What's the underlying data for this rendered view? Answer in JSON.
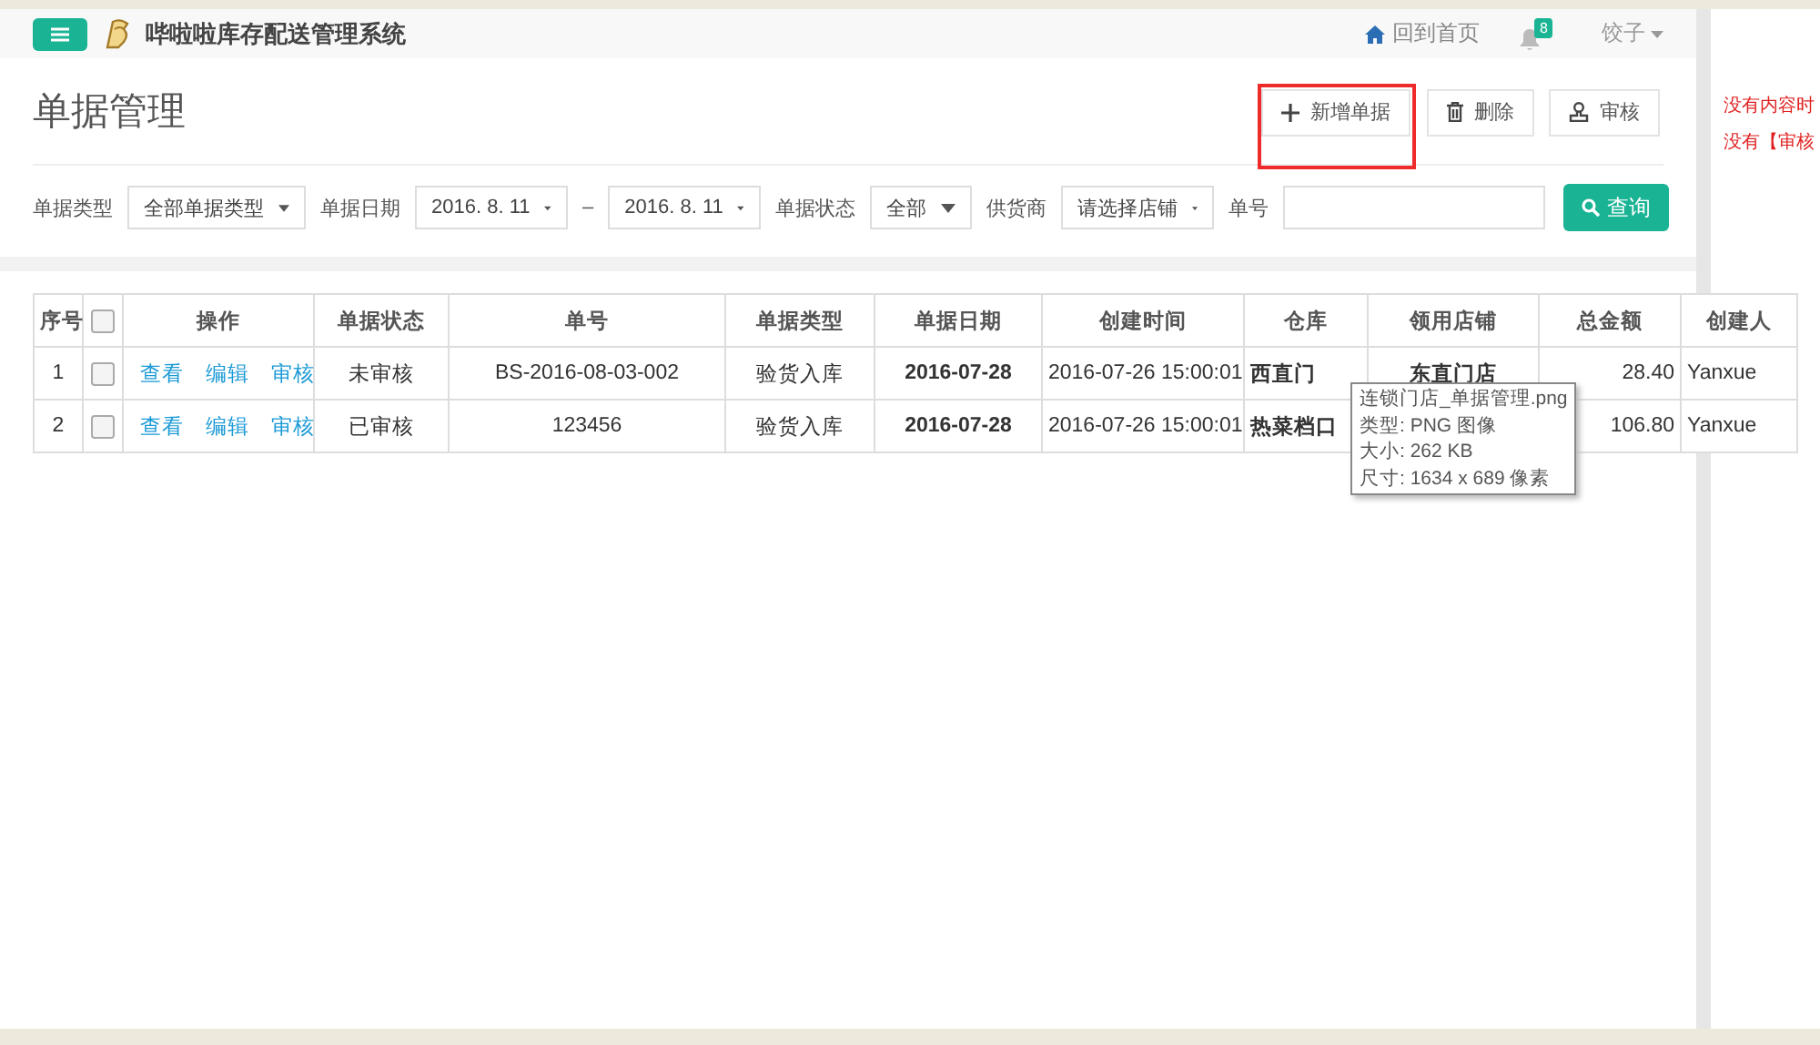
{
  "header": {
    "app_title": "哔啦啦库存配送管理系统",
    "home_link": "回到首页",
    "notification_count": "8",
    "user": "饺子"
  },
  "page": {
    "title": "单据管理",
    "actions": [
      {
        "kind": "add",
        "label": "新增单据",
        "highlighted": true
      },
      {
        "kind": "delete",
        "label": "删除",
        "highlighted": false
      },
      {
        "kind": "audit",
        "label": "审核",
        "highlighted": false
      }
    ]
  },
  "filters": {
    "type_label": "单据类型",
    "type_value": "全部单据类型",
    "date_label": "单据日期",
    "date_from": "2016. 8. 11",
    "date_sep": "–",
    "date_to": "2016. 8. 11",
    "status_label": "单据状态",
    "status_value": "全部",
    "supplier_label": "供货商",
    "supplier_value": "请选择店铺",
    "number_label": "单号",
    "search_button": "查询"
  },
  "table": {
    "select_all_checked": false,
    "columns": [
      "序号",
      "操作",
      "单据状态",
      "单号",
      "单据类型",
      "单据日期",
      "创建时间",
      "仓库",
      "领用店铺",
      "总金额",
      "创建人"
    ],
    "rows": [
      {
        "index": "1",
        "checked": false,
        "ops": [
          "查看",
          "编辑",
          "审核"
        ],
        "status": "未审核",
        "number": "BS-2016-08-03-002",
        "type": "验货入库",
        "date": "2016-07-28",
        "created": "2016-07-26 15:00:01",
        "warehouse": "西直门",
        "store": "东直门店",
        "amount": "28.40",
        "creator": "Yanxue"
      },
      {
        "index": "2",
        "checked": false,
        "ops": [
          "查看",
          "编辑",
          "审核"
        ],
        "status": "已审核",
        "number": "123456",
        "type": "验货入库",
        "date": "2016-07-28",
        "created": "2016-07-26 15:00:01",
        "warehouse": "热菜档口",
        "amount": "106.80",
        "creator": "Yanxue"
      }
    ]
  },
  "tooltip": [
    "连锁门店_单据管理.png",
    "类型: PNG 图像",
    "大小: 262 KB",
    "尺寸: 1634 x 689 像素"
  ],
  "side_notes": [
    "没有内容时",
    "没有【审核"
  ]
}
